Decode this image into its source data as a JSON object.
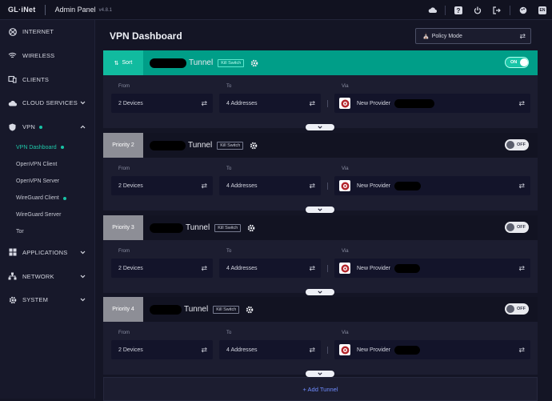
{
  "topbar": {
    "logo": "GL·iNet",
    "app_title": "Admin Panel",
    "version": "v4.8.1",
    "lang": "EN",
    "icons": [
      "cloud-icon",
      "help-icon",
      "power-icon",
      "logout-icon",
      "theme-icon"
    ]
  },
  "sidebar": {
    "items": [
      {
        "label": "INTERNET",
        "icon": "globe-icon"
      },
      {
        "label": "WIRELESS",
        "icon": "wifi-icon"
      },
      {
        "label": "CLIENTS",
        "icon": "devices-icon"
      },
      {
        "label": "CLOUD SERVICES",
        "icon": "cloud-icon"
      },
      {
        "label": "VPN",
        "icon": "shield-icon"
      }
    ],
    "vpn_sub": [
      {
        "label": "VPN Dashboard",
        "active": true,
        "dot": true
      },
      {
        "label": "OpenVPN Client",
        "active": false,
        "dot": false
      },
      {
        "label": "OpenVPN Server",
        "active": false,
        "dot": false
      },
      {
        "label": "WireGuard Client",
        "active": false,
        "dot": true
      },
      {
        "label": "WireGuard Server",
        "active": false,
        "dot": false
      },
      {
        "label": "Tor",
        "active": false,
        "dot": false
      }
    ],
    "bottom_items": [
      {
        "label": "APPLICATIONS",
        "icon": "grid-icon"
      },
      {
        "label": "NETWORK",
        "icon": "network-icon"
      },
      {
        "label": "SYSTEM",
        "icon": "gear-icon"
      }
    ]
  },
  "main": {
    "title": "VPN Dashboard",
    "policy_mode": "Policy Mode",
    "add_tunnel": "+ Add Tunnel",
    "labels": {
      "from": "From",
      "to": "To",
      "via": "Via"
    },
    "accent": "#009e88",
    "tunnels": [
      {
        "priority": "Sort",
        "name": "Tunnel",
        "kill_switch": "Kill Switch",
        "state": "ON",
        "from": "2 Devices",
        "to": "4 Addresses",
        "via": "New Provider"
      },
      {
        "priority": "Priority 2",
        "name": "Tunnel",
        "kill_switch": "Kill Switch",
        "state": "OFF",
        "from": "2 Devices",
        "to": "4 Addresses",
        "via": "New Provider"
      },
      {
        "priority": "Priority 3",
        "name": "Tunnel",
        "kill_switch": "Kill Switch",
        "state": "OFF",
        "from": "2 Devices",
        "to": "4 Addresses",
        "via": "New Provider"
      },
      {
        "priority": "Priority 4",
        "name": "Tunnel",
        "kill_switch": "Kill Switch",
        "state": "OFF",
        "from": "2 Devices",
        "to": "4 Addresses",
        "via": "New Provider"
      }
    ]
  }
}
